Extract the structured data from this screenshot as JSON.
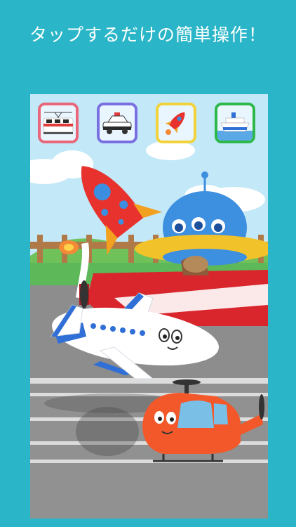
{
  "promo": {
    "headline": "タップするだけの簡単操作！"
  },
  "screen": {
    "tabs": [
      {
        "name": "train",
        "icon": "train-icon",
        "border_color": "#e8677a"
      },
      {
        "name": "police-car",
        "icon": "police-car-icon",
        "border_color": "#7a6fe0"
      },
      {
        "name": "rocket",
        "icon": "rocket-icon",
        "border_color": "#f2d23a"
      },
      {
        "name": "ship",
        "icon": "ship-icon",
        "border_color": "#2db84a"
      }
    ]
  },
  "colors": {
    "background": "#2ab6c8",
    "sky": "#bfe6f7",
    "rocket": "#e8322d",
    "ufo": "#3d8fe0",
    "biplane": "#d8262c",
    "jet": "#ffffff",
    "helicopter": "#f2582a",
    "runway": "#8f8f8f"
  }
}
